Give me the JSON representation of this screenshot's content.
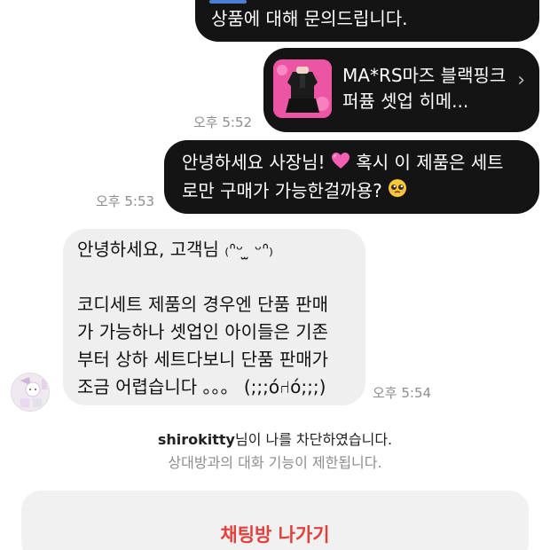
{
  "messages": {
    "m1": {
      "text": "상품에 대해 문의드립니다."
    },
    "m2": {
      "product_title": "MA*RS마즈 블랙핑크 퍼퓸 셋업 히메...",
      "chevron": "›",
      "time": "오후 5:52"
    },
    "m3": {
      "line1": "안녕하세요 사장님!",
      "line1b": "혹시 이 제품은 세트",
      "line2": "로만 구매가 가능한걸까용?",
      "time": "오후 5:53",
      "emoji1": "pink-heart-icon",
      "emoji2": "pleading-face-icon"
    },
    "m4": {
      "line1": "안녕하세요, 고객님 ₍ᐢᵕ ̫ ᵕᐢ₎",
      "line3": "코디세트 제품의 경우엔 단품 판매",
      "line4": "가 가능하나 셋업인 아이들은 기존",
      "line5": "부터 상하 세트다보니 단품 판매가",
      "line6": "조금 어렵습니다 。。。 (;;;ό⑁ó;;;)",
      "time": "오후 5:54"
    }
  },
  "notice": {
    "username": "shirokitty",
    "blocked_suffix": "님이 나를 차단하였습니다.",
    "restricted": "상대방과의 대화 기능이 제한됩니다."
  },
  "actions": {
    "leave_label": "채팅방 나가기"
  },
  "colors": {
    "outgoing_bubble": "#141414",
    "incoming_bubble": "#efefef",
    "leave_text": "#e1423d",
    "timestamp": "#8e8e8e"
  }
}
